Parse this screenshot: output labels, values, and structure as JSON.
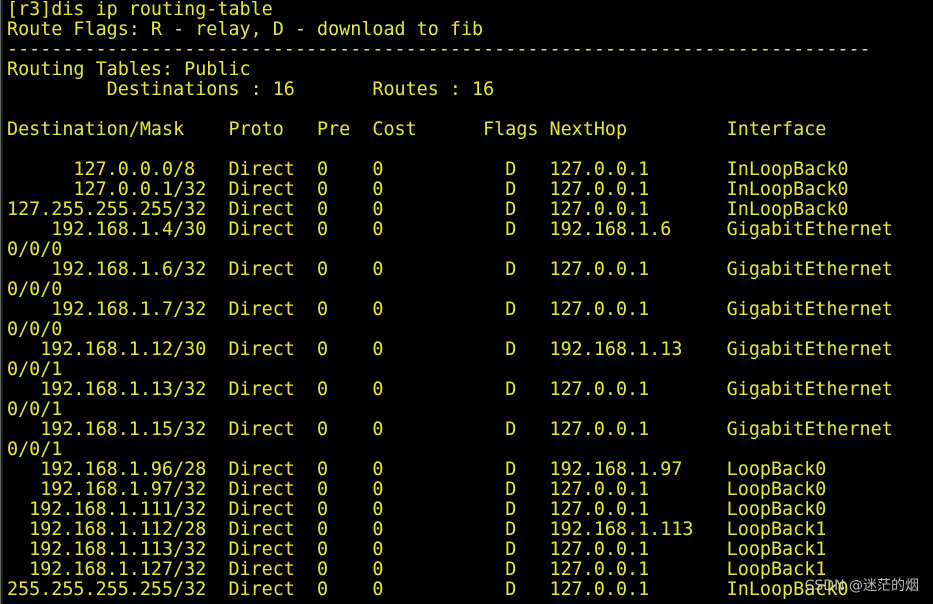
{
  "terminal": {
    "lines": [
      "[r3]dis ip routing-table",
      "Route Flags: R - relay, D - download to fib",
      "------------------------------------------------------------------------------",
      "Routing Tables: Public",
      "         Destinations : 16       Routes : 16",
      "",
      "Destination/Mask    Proto   Pre  Cost      Flags NextHop         Interface",
      "",
      "      127.0.0.0/8   Direct  0    0           D   127.0.0.1       InLoopBack0",
      "      127.0.0.1/32  Direct  0    0           D   127.0.0.1       InLoopBack0",
      "127.255.255.255/32  Direct  0    0           D   127.0.0.1       InLoopBack0",
      "    192.168.1.4/30  Direct  0    0           D   192.168.1.6     GigabitEthernet",
      "0/0/0",
      "    192.168.1.6/32  Direct  0    0           D   127.0.0.1       GigabitEthernet",
      "0/0/0",
      "    192.168.1.7/32  Direct  0    0           D   127.0.0.1       GigabitEthernet",
      "0/0/0",
      "   192.168.1.12/30  Direct  0    0           D   192.168.1.13    GigabitEthernet",
      "0/0/1",
      "   192.168.1.13/32  Direct  0    0           D   127.0.0.1       GigabitEthernet",
      "0/0/1",
      "   192.168.1.15/32  Direct  0    0           D   127.0.0.1       GigabitEthernet",
      "0/0/1",
      "   192.168.1.96/28  Direct  0    0           D   192.168.1.97    LoopBack0",
      "   192.168.1.97/32  Direct  0    0           D   127.0.0.1       LoopBack0",
      "  192.168.1.111/32  Direct  0    0           D   127.0.0.1       LoopBack0",
      "  192.168.1.112/28  Direct  0    0           D   192.168.1.113   LoopBack1",
      "  192.168.1.113/32  Direct  0    0           D   127.0.0.1       LoopBack1",
      "  192.168.1.127/32  Direct  0    0           D   127.0.0.1       LoopBack1",
      "255.255.255.255/32  Direct  0    0           D   127.0.0.1       InLoopBack0"
    ]
  },
  "watermark": "CSDN @迷茫的烟",
  "colors": {
    "background": "#000000",
    "text": "#e7e73a"
  }
}
